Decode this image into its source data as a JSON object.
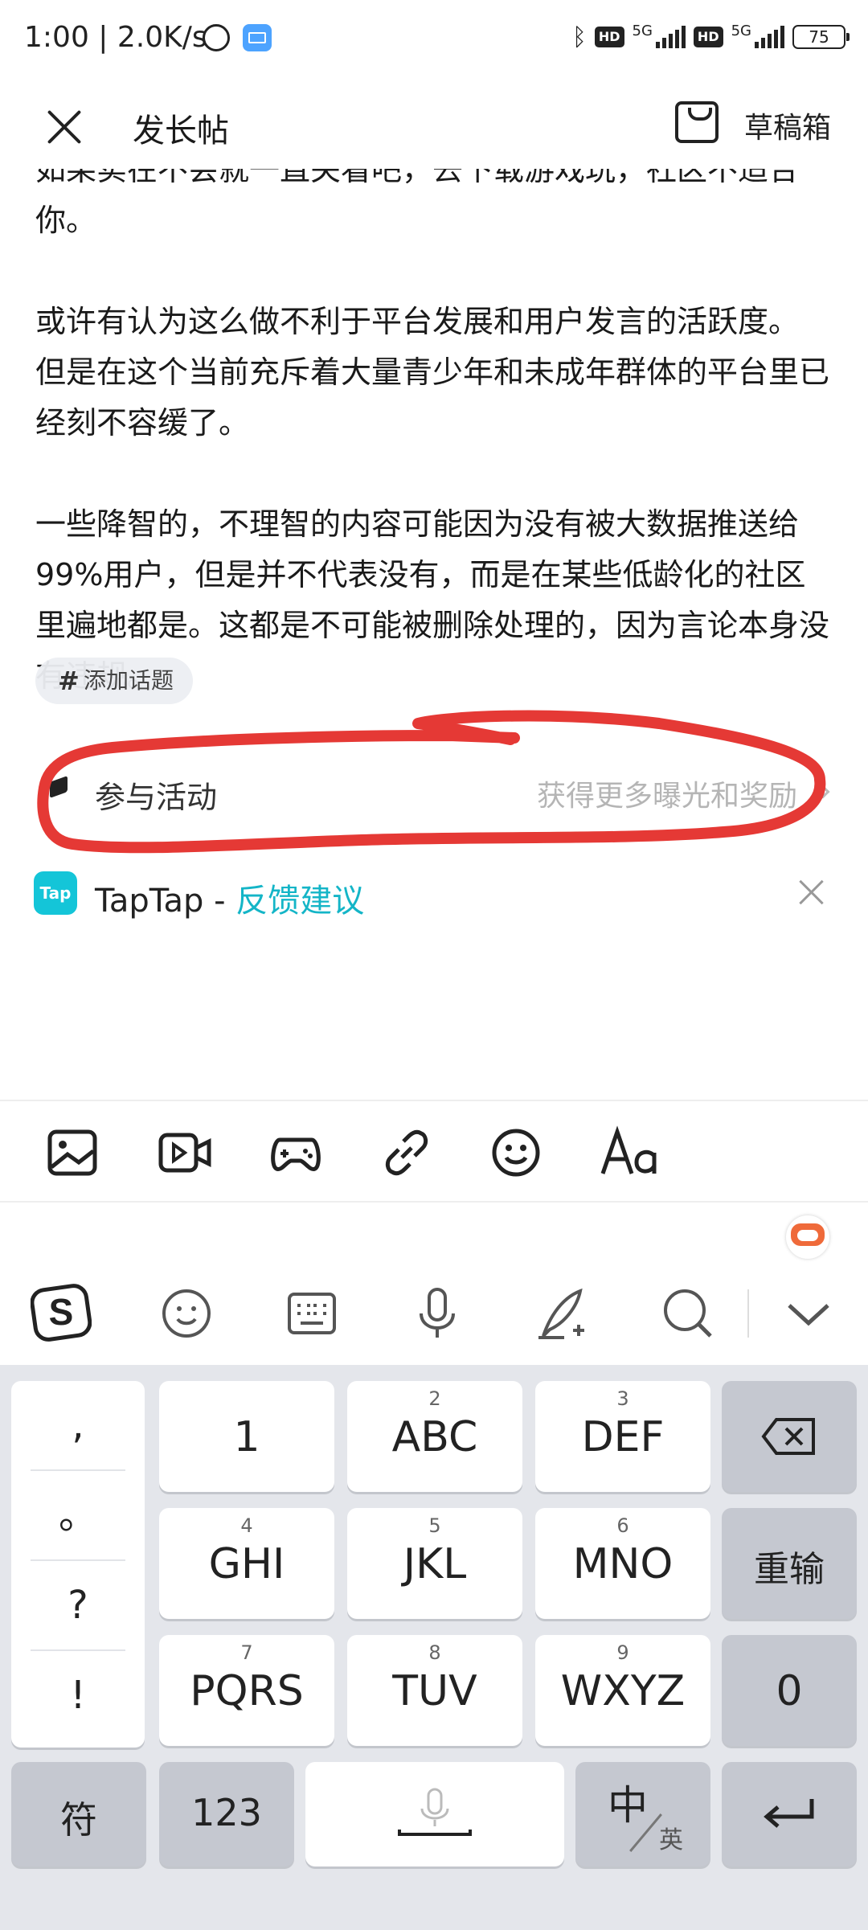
{
  "status_bar": {
    "time": "1:00 | 2.0K/s",
    "hd1": "HD",
    "net1": "5G",
    "hd2": "HD",
    "net2": "5G",
    "battery": "75"
  },
  "header": {
    "title": "发长帖",
    "drafts_label": "草稿箱"
  },
  "content": {
    "paragraphs": [
      "如果实在不会就一直关看吧，去下载游戏玩，社区不适合你。",
      "或许有认为这么做不利于平台发展和用户发言的活跃度。\n但是在这个当前充斥着大量青少年和未成年群体的平台里已经刻不容缓了。",
      "一些降智的，不理智的内容可能因为没有被大数据推送给99%用户，但是并不代表没有，而是在某些低龄化的社区里遍地都是。这都是不可能被删除处理的，因为言论本身没有违规。"
    ]
  },
  "topic_chip": {
    "hash": "#",
    "label": "添加话题"
  },
  "activity": {
    "label": "参与活动",
    "hint": "获得更多曝光和奖励"
  },
  "feedback": {
    "logo": "Tap",
    "app": "TapTap - ",
    "link": "反馈建议"
  },
  "toolbar": {
    "icons": [
      "image-icon",
      "video-icon",
      "gamepad-icon",
      "link-icon",
      "emoji-icon",
      "text-format-icon"
    ]
  },
  "ime_bar": {
    "icons": [
      "sogou-logo-icon",
      "emoji-icon",
      "keyboard-icon",
      "microphone-icon",
      "handwriting-icon",
      "search-icon",
      "chevron-down-icon"
    ]
  },
  "keyboard": {
    "punct": [
      ",",
      "。",
      "?",
      "!"
    ],
    "keys": [
      {
        "num": "",
        "label": "1"
      },
      {
        "num": "2",
        "label": "ABC"
      },
      {
        "num": "3",
        "label": "DEF"
      },
      {
        "num": "4",
        "label": "GHI"
      },
      {
        "num": "5",
        "label": "JKL"
      },
      {
        "num": "6",
        "label": "MNO"
      },
      {
        "num": "7",
        "label": "PQRS"
      },
      {
        "num": "8",
        "label": "TUV"
      },
      {
        "num": "9",
        "label": "WXYZ"
      }
    ],
    "reenter": "重输",
    "zero": "0",
    "symbols": "符",
    "numbers": "123",
    "zh": "中",
    "en": "英"
  },
  "colors": {
    "accent": "#14b5c7",
    "annotation": "#e53935"
  }
}
